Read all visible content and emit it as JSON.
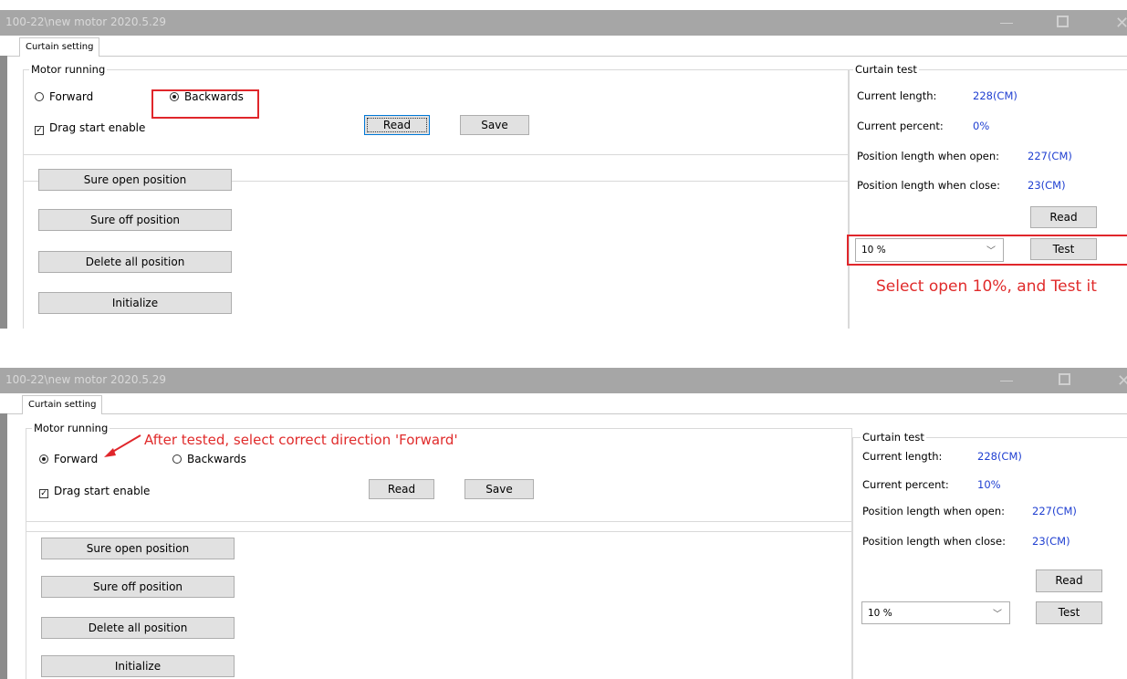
{
  "shot1": {
    "window_title": "100-22\\new motor 2020.5.29",
    "tab_label": "Curtain setting",
    "motor_group_label": "Motor running",
    "radio_forward": "Forward",
    "radio_backwards": "Backwards",
    "selected_direction": "Backwards",
    "drag_start_label": "Drag start enable",
    "drag_start_checked": true,
    "read_label": "Read",
    "save_label": "Save",
    "buttons": [
      "Sure open position",
      "Sure off position",
      "Delete all position",
      "Initialize"
    ],
    "test_group_label": "Curtain test",
    "current_length_label": "Current length:",
    "current_length_value": "228(CM)",
    "current_percent_label": "Current percent:",
    "current_percent_value": "0%",
    "open_length_label": "Position length when open:",
    "open_length_value": "227(CM)",
    "close_length_label": "Position length when close:",
    "close_length_value": "23(CM)",
    "test_read_label": "Read",
    "test_label": "Test",
    "select_value": "10 %",
    "annotation": "Select open 10%, and Test it"
  },
  "shot2": {
    "window_title": "100-22\\new motor 2020.5.29",
    "tab_label": "Curtain setting",
    "motor_group_label": "Motor running",
    "radio_forward": "Forward",
    "radio_backwards": "Backwards",
    "selected_direction": "Forward",
    "drag_start_label": "Drag start enable",
    "drag_start_checked": true,
    "read_label": "Read",
    "save_label": "Save",
    "buttons": [
      "Sure open position",
      "Sure off position",
      "Delete all position",
      "Initialize"
    ],
    "test_group_label": "Curtain test",
    "current_length_label": "Current length:",
    "current_length_value": "228(CM)",
    "current_percent_label": "Current percent:",
    "current_percent_value": "10%",
    "open_length_label": "Position length when open:",
    "open_length_value": "227(CM)",
    "close_length_label": "Position length when close:",
    "close_length_value": "23(CM)",
    "test_read_label": "Read",
    "test_label": "Test",
    "select_value": "10 %",
    "annotation": "After tested, select correct direction  'Forward'"
  },
  "colors": {
    "titlebar": "#a6a6a6",
    "value_blue": "#1f3fd1",
    "annotation_red": "#e0262b",
    "button_face": "#e1e1e1"
  }
}
